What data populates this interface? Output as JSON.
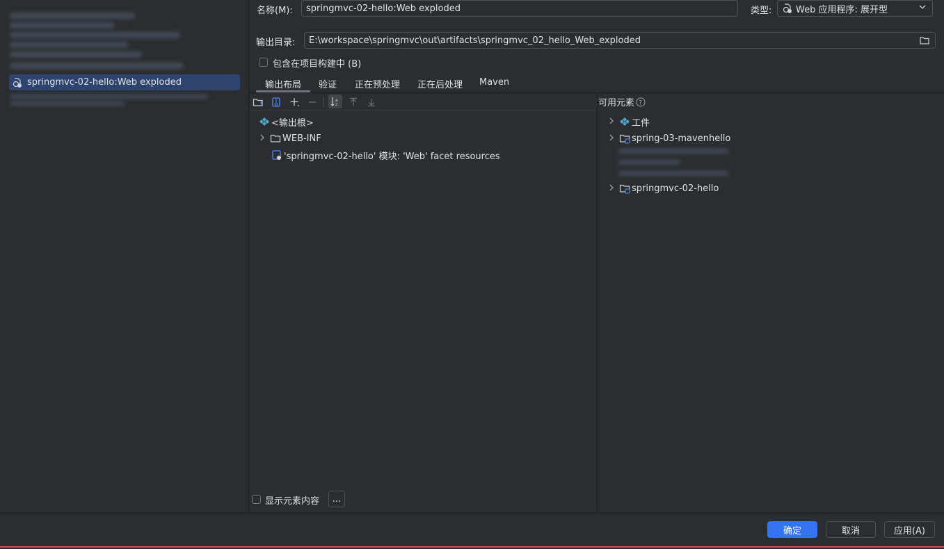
{
  "left_panel": {
    "selected_artifact": "springmvc-02-hello:Web exploded"
  },
  "form": {
    "name_label": "名称(M):",
    "name_value": "springmvc-02-hello:Web exploded",
    "type_label": "类型:",
    "type_value": "Web 应用程序: 展开型",
    "output_dir_label": "输出目录:",
    "output_dir_value": "E:\\workspace\\springmvc\\out\\artifacts\\springmvc_02_hello_Web_exploded",
    "include_in_build_label": "包含在项目构建中 (B)"
  },
  "tabs": [
    {
      "label": "输出布局",
      "active": true
    },
    {
      "label": "验证",
      "active": false
    },
    {
      "label": "正在预处理",
      "active": false
    },
    {
      "label": "正在后处理",
      "active": false
    },
    {
      "label": "Maven",
      "active": false
    }
  ],
  "output_tree": [
    {
      "label": "<输出根>",
      "icon": "output-root-icon"
    },
    {
      "label": "WEB-INF",
      "icon": "folder-icon",
      "expandable": true
    },
    {
      "label": "'springmvc-02-hello' 模块: 'Web' facet resources",
      "icon": "web-module-icon"
    }
  ],
  "available_elements": {
    "title": "可用元素",
    "items": [
      {
        "label": "工件",
        "icon": "artifact-icon"
      },
      {
        "label": "spring-03-mavenhello",
        "icon": "module-folder-icon"
      },
      {
        "label": "springmvc-02-hello",
        "icon": "module-folder-icon"
      }
    ]
  },
  "footer": {
    "show_content_label": "显示元素内容",
    "more_label": "...",
    "ok_label": "确定",
    "cancel_label": "取消",
    "apply_label": "应用(A)"
  },
  "colors": {
    "accent": "#3574f0",
    "background": "#2b2d30",
    "selection": "#2e436e"
  }
}
